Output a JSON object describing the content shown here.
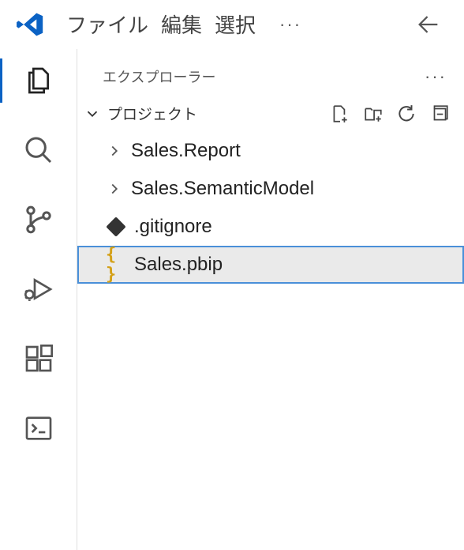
{
  "menu": {
    "file": "ファイル",
    "edit": "編集",
    "select": "選択"
  },
  "sidebar": {
    "title": "エクスプローラー",
    "section": "プロジェクト"
  },
  "tree": {
    "items": [
      {
        "label": "Sales.Report"
      },
      {
        "label": "Sales.SemanticModel"
      },
      {
        "label": ".gitignore"
      },
      {
        "label": "Sales.pbip"
      }
    ]
  }
}
